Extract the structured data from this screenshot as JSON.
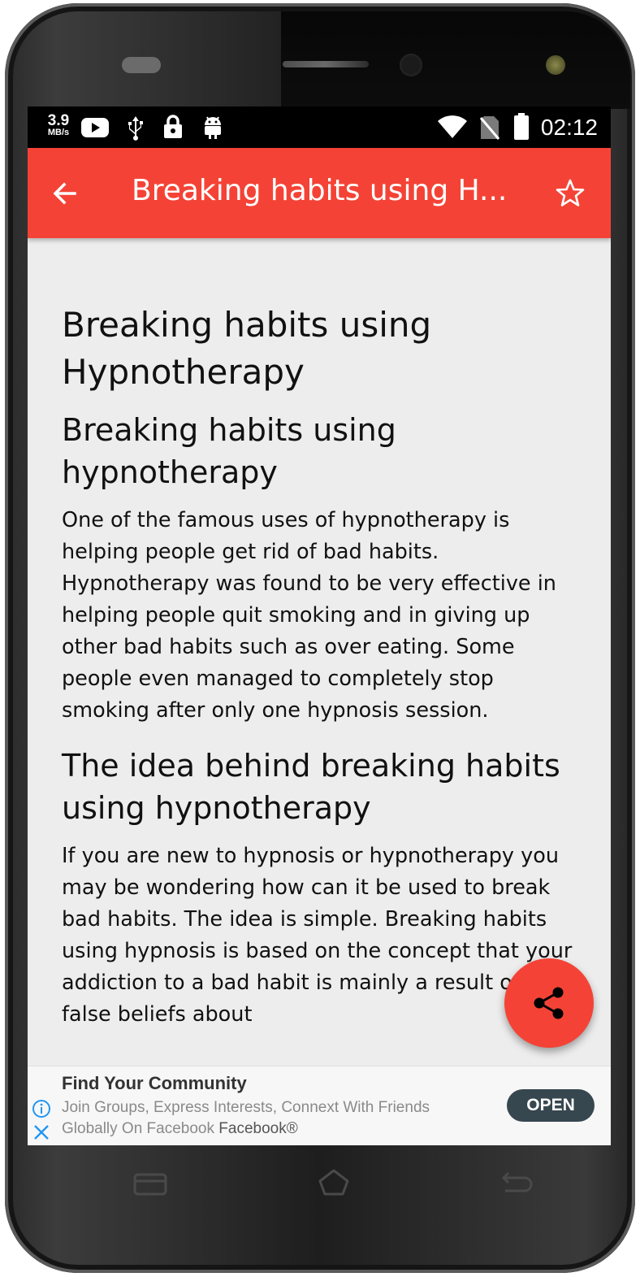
{
  "status_bar": {
    "net_speed_value": "3.9",
    "net_speed_unit": "MB/s",
    "time": "02:12",
    "icons": [
      "youtube-icon",
      "usb-icon",
      "lock-icon",
      "android-icon",
      "wifi-icon",
      "no-sim-icon",
      "battery-icon"
    ]
  },
  "app_bar": {
    "title": "Breaking habits using H...",
    "back_icon": "arrow-left-icon",
    "favorite_icon": "star-outline-icon",
    "color": "#f44336"
  },
  "article": {
    "title": "Breaking habits using Hypnotherapy",
    "sections": [
      {
        "heading": "Breaking habits using hypnotherapy",
        "body": "One of the famous uses of hypnotherapy is helping people get rid of bad habits. Hypnotherapy was found to be very effective in helping people quit smoking and in giving up other bad habits such as over eating. Some people even managed to completely stop smoking after only one hypnosis session."
      },
      {
        "heading": "The idea behind breaking habits using hypnotherapy",
        "body": "If you are new to hypnosis or hypnotherapy you may be wondering how can it be used to break bad habits. The idea is simple. Breaking habits using hypnosis is based on the concept that your addiction to a bad habit is mainly a result of your false beliefs about"
      }
    ]
  },
  "fab": {
    "icon": "share-icon"
  },
  "ad": {
    "title": "Find Your Community",
    "line1": "Join Groups, Express Interests, Connext With Friends",
    "line2": "Globally On Facebook",
    "advertiser": "Facebook®",
    "cta": "OPEN",
    "cta_color": "#37474f"
  },
  "nav_bar": {
    "icons": [
      "recent-apps-icon",
      "home-icon",
      "back-nav-icon"
    ]
  }
}
